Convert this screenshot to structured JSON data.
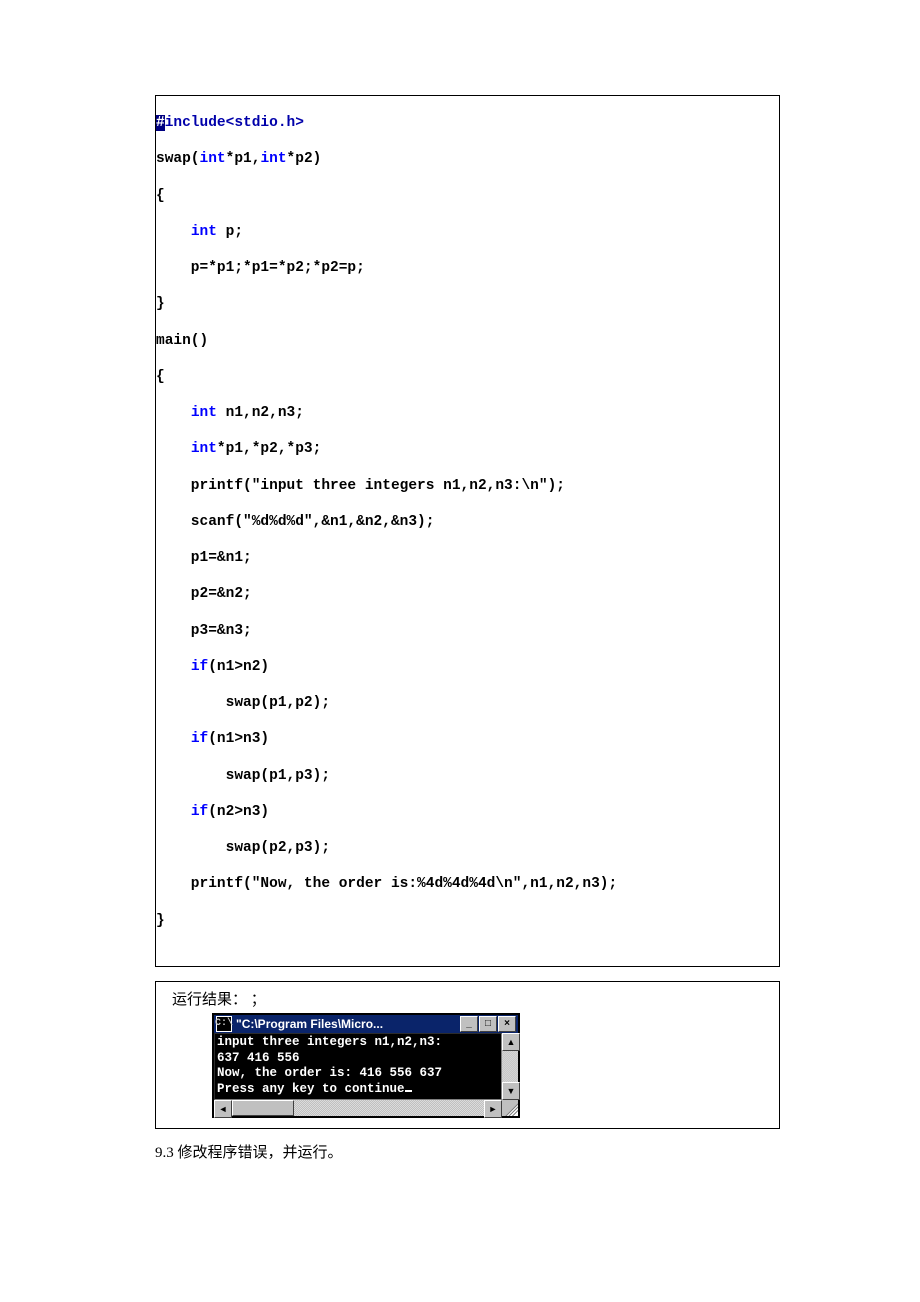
{
  "code": {
    "l01a": "#",
    "l01b": "include",
    "l01c": "<stdio.h>",
    "l02a": "swap(",
    "l02b": "int",
    "l02c": "*p1,",
    "l02d": "int",
    "l02e": "*p2)",
    "l03": "{",
    "l04a": "    ",
    "l04b": "int",
    "l04c": " p;",
    "l05": "    p=*p1;*p1=*p2;*p2=p;",
    "l06": "}",
    "l07": "main()",
    "l08": "{",
    "l09a": "    ",
    "l09b": "int",
    "l09c": " n1,n2,n3;",
    "l10a": "    ",
    "l10b": "int",
    "l10c": "*p1,*p2,*p3;",
    "l11": "    printf(\"input three integers n1,n2,n3:\\n\");",
    "l12": "    scanf(\"%d%d%d\",&n1,&n2,&n3);",
    "l13": "    p1=&n1;",
    "l14": "    p2=&n2;",
    "l15": "    p3=&n3;",
    "l16a": "    ",
    "l16b": "if",
    "l16c": "(n1>n2)",
    "l17": "        swap(p1,p2);",
    "l18a": "    ",
    "l18b": "if",
    "l18c": "(n1>n3)",
    "l19": "        swap(p1,p3);",
    "l20a": "    ",
    "l20b": "if",
    "l20c": "(n2>n3)",
    "l21": "        swap(p2,p3);",
    "l22": "    printf(\"Now, the order is:%4d%4d%4d\\n\",n1,n2,n3);",
    "l23": "}"
  },
  "result_label": "运行结果：   ；",
  "console": {
    "sysicon": "C:\\",
    "title": "\"C:\\Program Files\\Micro...",
    "btn_min": "_",
    "btn_max": "□",
    "btn_close": "×",
    "line1": "input three integers n1,n2,n3:",
    "line2": "637 416 556",
    "line3": "Now, the order is: 416 556 637",
    "line4": "Press any key to continue",
    "scroll_up": "▲",
    "scroll_down": "▼",
    "scroll_left": "◄",
    "scroll_right": "►"
  },
  "footer": "9.3  修改程序错误，并运行。"
}
